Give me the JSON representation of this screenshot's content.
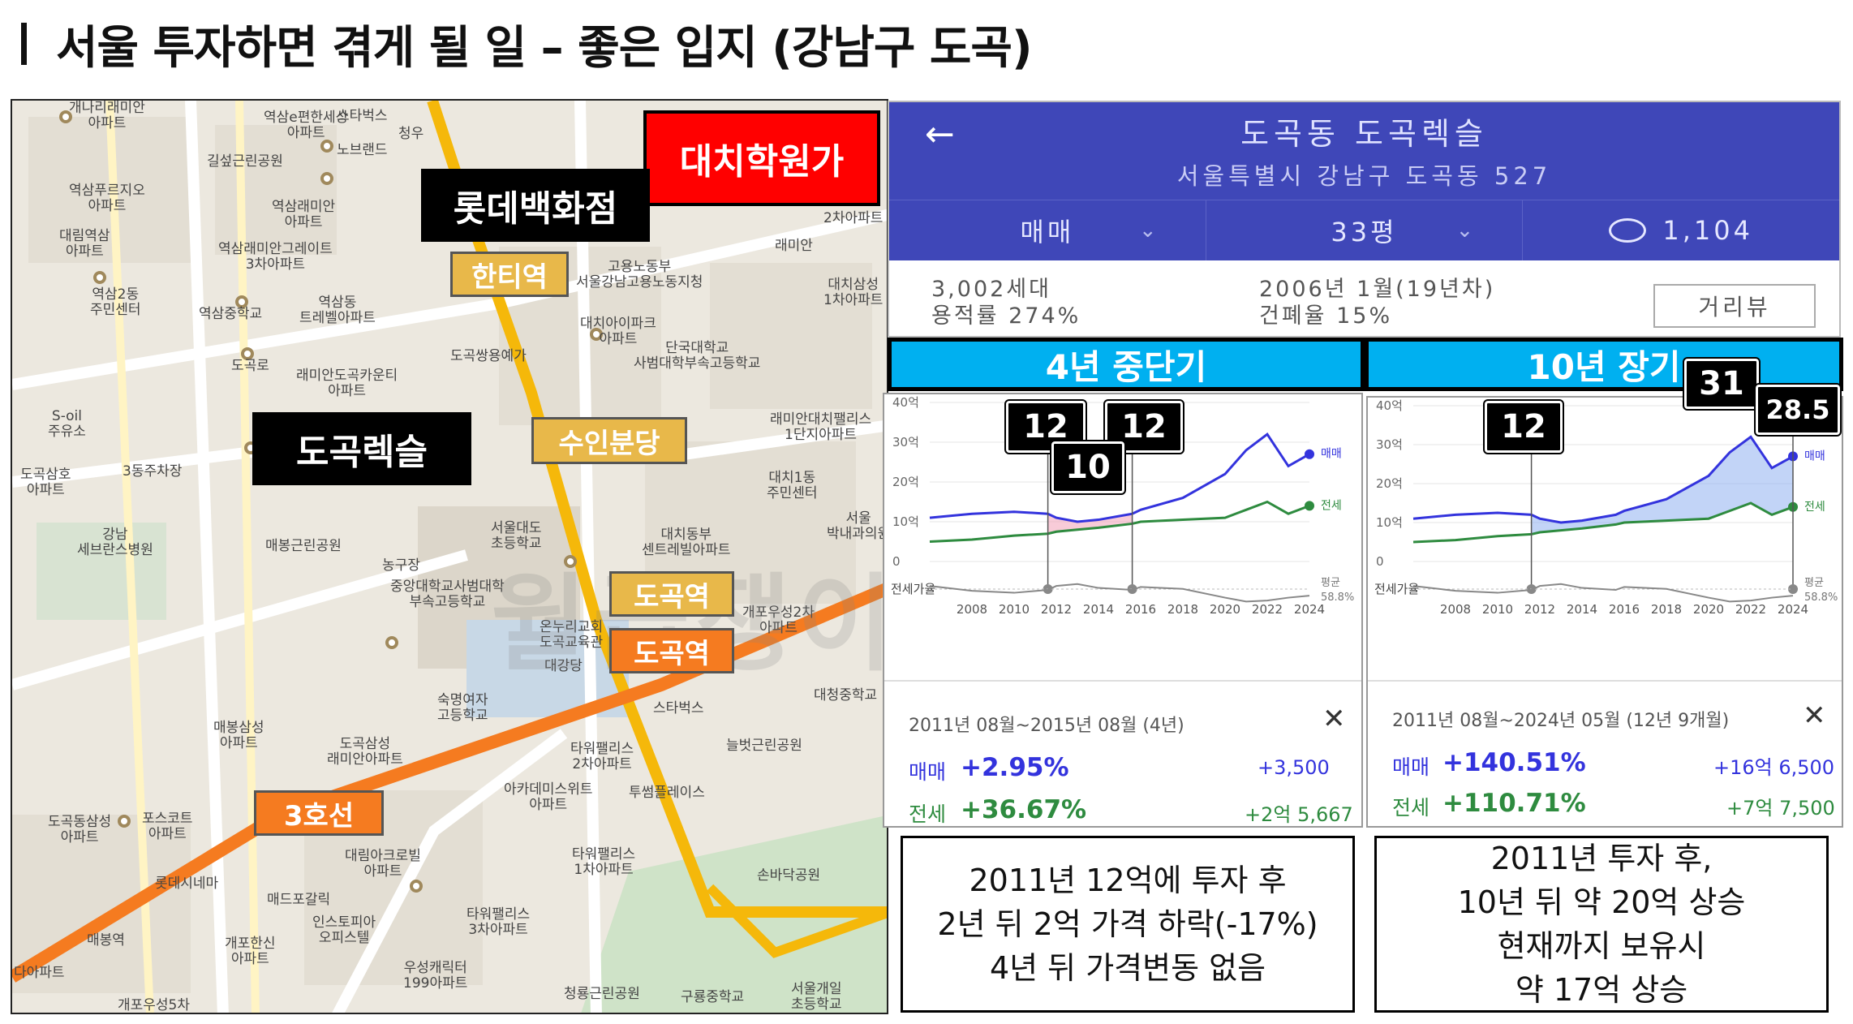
{
  "title": "서울 투자하면 겪게 될 일 – 좋은 입지 (강남구 도곡)",
  "map": {
    "watermark": "월급쟁이부자들",
    "highlight_boxes": {
      "daechi_academy": "대치학원가",
      "lotte_dept": "롯데백화점",
      "hanti_station": "한티역",
      "dogok_rexle": "도곡렉슬",
      "suin_bundang": "수인분당",
      "dogok_station_1": "도곡역",
      "dogok_station_2": "도곡역",
      "line3": "3호선"
    },
    "labels": [
      "개나리래미안\n아파트",
      "역삼e편한세상\n아파트",
      "스타벅스",
      "노브랜드",
      "청우",
      "길섶근린공원",
      "역삼푸르지오\n아파트",
      "역삼래미안\n아파트",
      "대림역삼\n아파트",
      "역삼래미안그레이트\n3차아파트",
      "역삼2동\n주민센터",
      "역삼중학교",
      "역삼동\n트레벨아파트",
      "고용노동부\n서울강남고용노동지청",
      "대치삼성\n1차아파트",
      "대치아이파크\n아파트",
      "도곡쌍용예가",
      "단국대학교\n사범대학부속고등학교",
      "래미안도곡카운티\n아파트",
      "도곡로",
      "S-oil\n주유소",
      "도곡삼호\n아파트",
      "3동주차장",
      "래미안대치팰리스\n1단지아파트",
      "대치1동\n주민센터",
      "강남\n세브란스병원",
      "서울대도\n초등학교",
      "대치동부\n센트레빌아파트",
      "서울\n박내과의원",
      "매봉근린공원",
      "농구장",
      "중앙대학교사범대학\n부속고등학교",
      "온누리교회\n도곡교육관",
      "개포우성2차\n아파트",
      "대강당",
      "숙명여자\n고등학교",
      "스타벅스",
      "대청중학교",
      "매봉삼성\n아파트",
      "도곡삼성\n래미안아파트",
      "타워팰리스\n2차아파트",
      "늘벗근린공원",
      "아카데미스위트\n아파트",
      "투썸플레이스",
      "도곡동삼성\n아파트",
      "포스코트\n아파트",
      "대림아크로빌\n아파트",
      "타워팰리스\n1차아파트",
      "매드포갈릭",
      "롯데시네마",
      "인스토피아\n오피스텔",
      "타워팰리스\n3차아파트",
      "개포한신\n아파트",
      "우성캐릭터\n199아파트",
      "손바닥공원",
      "청룡근린공원",
      "구룡중학교",
      "서울개일\n초등학교",
      "개포우성5차",
      "매봉역",
      "다아파트",
      "2차아파트",
      "래미안"
    ]
  },
  "app": {
    "back_icon": "arrow-left-icon",
    "title": "도곡동 도곡렉슬",
    "address": "서울특별시 강남구 도곡동 527",
    "tabs": {
      "deal": "매매",
      "size": "33평",
      "comments": "1,104"
    },
    "info_left": [
      "3,002세대",
      "용적률 274%"
    ],
    "info_mid": [
      "2006년 1월(19년차)",
      "건폐율 15%"
    ],
    "street_view": "거리뷰"
  },
  "periods": {
    "mid": "4년 중단기",
    "long": "10년 장기"
  },
  "charts": [
    {
      "range": "2011년 08월~2015년 08월 (4년)",
      "sale_label": "매매",
      "sale_pct": "+2.95%",
      "sale_amt": "+3,500",
      "jeonse_label": "전세",
      "jeonse_pct": "+36.67%",
      "jeonse_amt": "+2억 5,667",
      "callouts": [
        "12",
        "12",
        "10"
      ]
    },
    {
      "range": "2011년 08월~2024년 05월 (12년 9개월)",
      "sale_label": "매매",
      "sale_pct": "+140.51%",
      "sale_amt": "+16억 6,500",
      "jeonse_label": "전세",
      "jeonse_pct": "+110.71%",
      "jeonse_amt": "+7억 7,500",
      "callouts": [
        "12",
        "31",
        "28.5"
      ]
    }
  ],
  "chart_data": [
    {
      "type": "line",
      "x": [
        2006,
        2008,
        2010,
        2011.6,
        2012,
        2013,
        2014,
        2015.6,
        2016,
        2018,
        2020,
        2021,
        2022,
        2023,
        2024
      ],
      "series": [
        {
          "name": "매매",
          "values": [
            11,
            12,
            12.5,
            12,
            11,
            10,
            10.5,
            12,
            13,
            16,
            22,
            28,
            32,
            24,
            27
          ]
        },
        {
          "name": "전세",
          "values": [
            5,
            5.5,
            6.5,
            7,
            7.5,
            8,
            8.5,
            9.5,
            10,
            10.5,
            11,
            13,
            15,
            12,
            14
          ]
        }
      ],
      "ratio_label": "전세가율",
      "avg_label": "평균\n58.8%",
      "y_ticks": [
        "40억",
        "30억",
        "20억",
        "10억",
        "0"
      ],
      "x_ticks": [
        "2008",
        "2010",
        "2012",
        "2014",
        "2016",
        "2018",
        "2020",
        "2022",
        "2024"
      ],
      "ylim": [
        0,
        40
      ]
    }
  ],
  "notes": {
    "mid": [
      "2011년 12억에 투자 후",
      "2년 뒤 2억 가격 하락(-17%)",
      "4년 뒤 가격변동 없음"
    ],
    "long": [
      "2011년 투자 후,",
      "10년 뒤 약 20억 상승",
      "현재까지 보유시",
      "약 17억 상승"
    ]
  },
  "colors": {
    "sale": "#3333dd",
    "jeonse": "#2e8b3f",
    "header": "#3f47b8",
    "period": "#00b0f0",
    "accent_red": "#ff0000"
  }
}
